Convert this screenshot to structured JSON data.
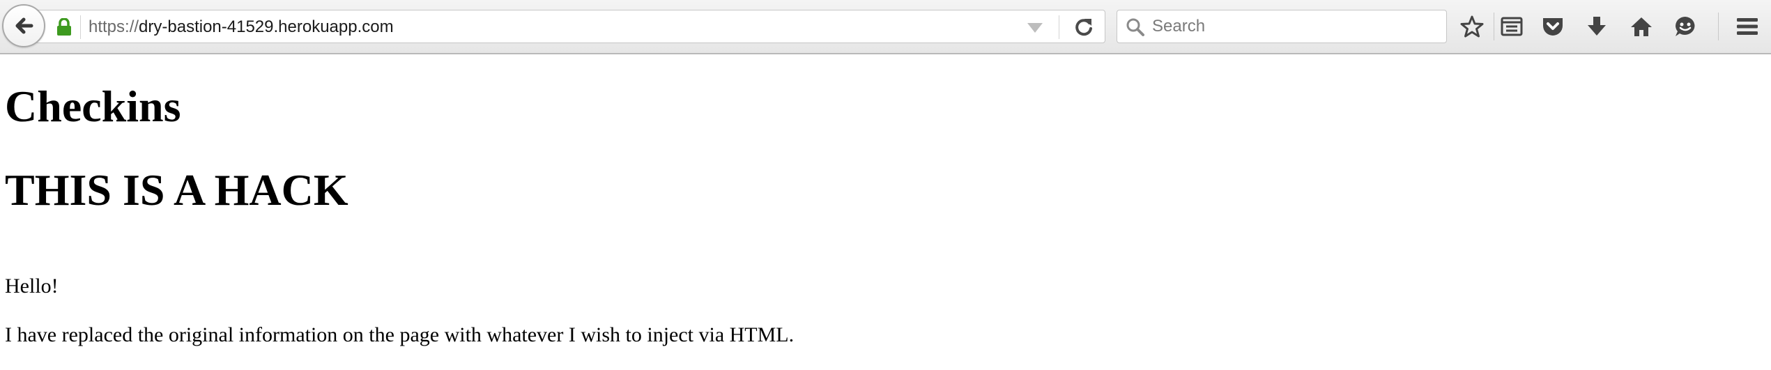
{
  "browser": {
    "url_scheme": "https://",
    "url_host": "dry-bastion-41529.herokuapp.com",
    "search_placeholder": "Search",
    "toolbar_icons": [
      "back-icon",
      "lock-icon",
      "dropmarker-icon",
      "reload-icon",
      "search-icon",
      "bookmark-star-icon",
      "reading-list-icon",
      "pocket-icon",
      "download-icon",
      "home-icon",
      "chat-icon",
      "menu-icon"
    ],
    "colors": {
      "lock": "#3d9a1f",
      "icon": "#444444",
      "toolbar_bg": "#ececec"
    }
  },
  "page": {
    "heading_1": "Checkins",
    "heading_2": "THIS IS A HACK",
    "paragraph_1": "Hello!",
    "paragraph_2": "I have replaced the original information on the page with whatever I wish to inject via HTML."
  }
}
